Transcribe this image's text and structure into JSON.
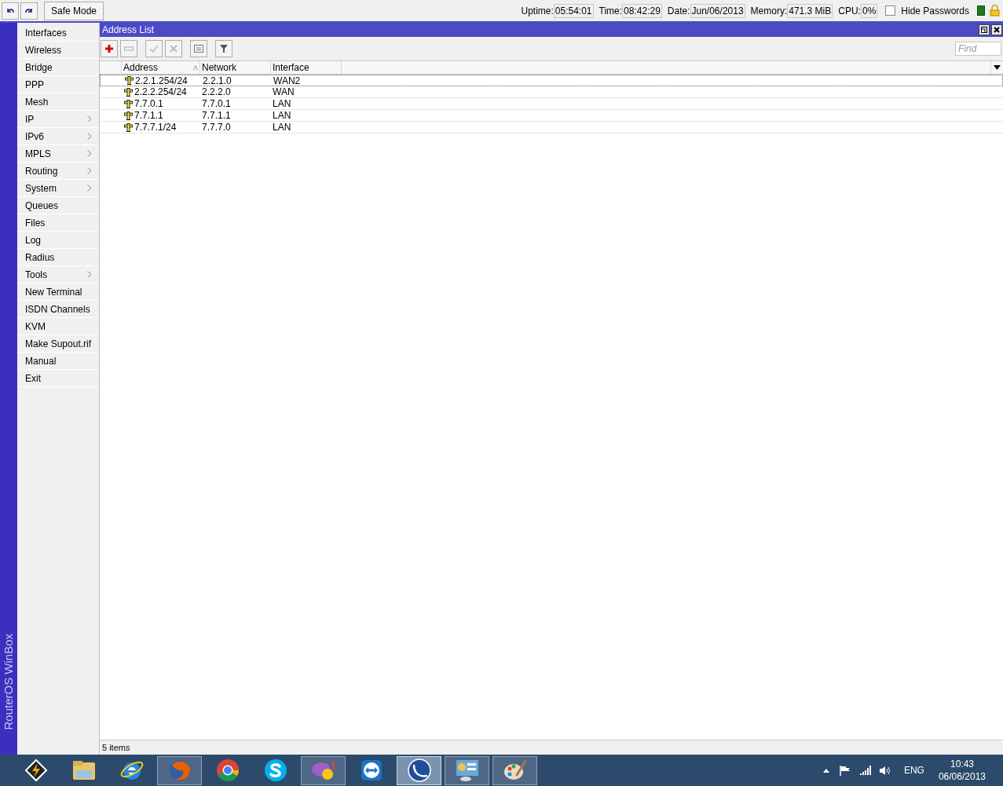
{
  "top_bar": {
    "safe_mode": "Safe Mode",
    "stats": [
      {
        "label": "Uptime:",
        "value": "05:54:01"
      },
      {
        "label": "Time:",
        "value": "08:42:29"
      },
      {
        "label": "Date:",
        "value": "Jun/06/2013"
      },
      {
        "label": "Memory:",
        "value": "471.3 MiB"
      },
      {
        "label": "CPU:",
        "value": "0%"
      }
    ],
    "hide_passwords": {
      "label": "Hide Passwords",
      "checked": false
    }
  },
  "side_label": "RouterOS WinBox",
  "sidebar": {
    "items": [
      {
        "label": "Interfaces",
        "submenu": false
      },
      {
        "label": "Wireless",
        "submenu": false
      },
      {
        "label": "Bridge",
        "submenu": false
      },
      {
        "label": "PPP",
        "submenu": false
      },
      {
        "label": "Mesh",
        "submenu": false
      },
      {
        "label": "IP",
        "submenu": true
      },
      {
        "label": "IPv6",
        "submenu": true
      },
      {
        "label": "MPLS",
        "submenu": true
      },
      {
        "label": "Routing",
        "submenu": true
      },
      {
        "label": "System",
        "submenu": true
      },
      {
        "label": "Queues",
        "submenu": false
      },
      {
        "label": "Files",
        "submenu": false
      },
      {
        "label": "Log",
        "submenu": false
      },
      {
        "label": "Radius",
        "submenu": false
      },
      {
        "label": "Tools",
        "submenu": true
      },
      {
        "label": "New Terminal",
        "submenu": false
      },
      {
        "label": "ISDN Channels",
        "submenu": false
      },
      {
        "label": "KVM",
        "submenu": false
      },
      {
        "label": "Make Supout.rif",
        "submenu": false
      },
      {
        "label": "Manual",
        "submenu": false
      },
      {
        "label": "Exit",
        "submenu": false
      }
    ]
  },
  "window": {
    "title": "Address List",
    "find": {
      "placeholder": "Find"
    },
    "table": {
      "columns": [
        {
          "label": "Address",
          "sorted": true
        },
        {
          "label": "Network",
          "sorted": false
        },
        {
          "label": "Interface",
          "sorted": false
        }
      ],
      "rows": [
        {
          "address": "2.2.1.254/24",
          "network": "2.2.1.0",
          "interface": "WAN2",
          "selected": true
        },
        {
          "address": "2.2.2.254/24",
          "network": "2.2.2.0",
          "interface": "WAN",
          "selected": false
        },
        {
          "address": "7.7.0.1",
          "network": "7.7.0.1",
          "interface": "LAN",
          "selected": false
        },
        {
          "address": "7.7.1.1",
          "network": "7.7.1.1",
          "interface": "LAN",
          "selected": false
        },
        {
          "address": "7.7.7.1/24",
          "network": "7.7.7.0",
          "interface": "LAN",
          "selected": false
        }
      ]
    },
    "status": "5 items"
  },
  "taskbar": {
    "apps": [
      {
        "kind": "bolt",
        "running": false,
        "selected": false
      },
      {
        "kind": "folder",
        "running": false,
        "selected": false
      },
      {
        "kind": "ie",
        "running": false,
        "selected": false
      },
      {
        "kind": "firefox",
        "running": true,
        "selected": false
      },
      {
        "kind": "chrome",
        "running": false,
        "selected": false
      },
      {
        "kind": "skype",
        "running": false,
        "selected": false
      },
      {
        "kind": "yahoo",
        "running": true,
        "selected": false
      },
      {
        "kind": "teamviewer",
        "running": false,
        "selected": false
      },
      {
        "kind": "winbox",
        "running": true,
        "selected": true
      },
      {
        "kind": "panel",
        "running": true,
        "selected": false
      },
      {
        "kind": "paint",
        "running": true,
        "selected": false
      }
    ],
    "language": "ENG",
    "time": "10:43",
    "date": "06/06/2013"
  }
}
